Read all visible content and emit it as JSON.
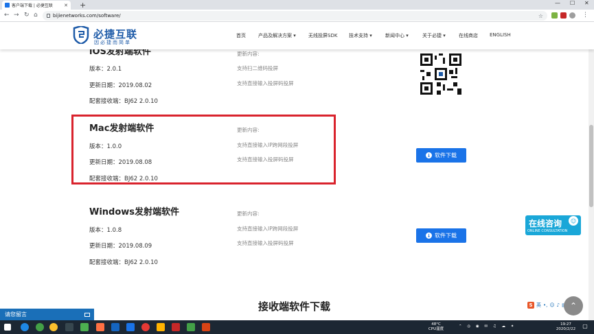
{
  "browser": {
    "tab_title": "客户端下载 | 必捷互联",
    "url": "bijienetworks.com/software/",
    "new_tab": "+",
    "minimize": "—",
    "maximize": "☐",
    "close": "✕"
  },
  "site": {
    "logo_name": "必捷互联",
    "logo_slogan": "因必捷而简单",
    "brand_color": "#1e5ba8",
    "nav": [
      "首页",
      "产品及解决方案",
      "无线投屏SDK",
      "技术支持",
      "新闻中心",
      "关于必捷",
      "在线商店",
      "ENGLISH"
    ]
  },
  "software": [
    {
      "title": "iOS发射端软件",
      "version": "版本：2.0.1",
      "date": "更新日期：2019.08.02",
      "receiver": "配套接收端：BJ62 2.0.10",
      "notes_label": "更新内容:",
      "notes": [
        "支持扫二维码投屏",
        "支持直接输入投屏码投屏"
      ]
    },
    {
      "title": "Mac发射端软件",
      "version": "版本：1.0.0",
      "date": "更新日期：2019.08.08",
      "receiver": "配套接收端：BJ62 2.0.10",
      "notes_label": "更新内容:",
      "notes": [
        "支持直接输入IP跨网段投屏",
        "支持直接输入投屏码投屏"
      ],
      "button": "软件下载"
    },
    {
      "title": "Windows发射端软件",
      "version": "版本：1.0.8",
      "date": "更新日期：2019.08.09",
      "receiver": "配套接收端：BJ62 2.0.10",
      "notes_label": "更新内容:",
      "notes": [
        "支持直接输入IP跨网段投屏",
        "支持直接输入投屏码投屏"
      ],
      "button": "软件下载"
    }
  ],
  "receiver_section_title": "接收端软件下载",
  "consult": {
    "main": "在线咨询",
    "sub": "ONLINE CONSULTATION"
  },
  "message_bar": "请您留言",
  "ime_label": "英",
  "taskbar": {
    "temp": "48°C",
    "cpu": "CPU温度",
    "time": "19:27",
    "date": "2020/2/22"
  },
  "highlight_color": "#d9232d",
  "accent": "#1a73e8"
}
